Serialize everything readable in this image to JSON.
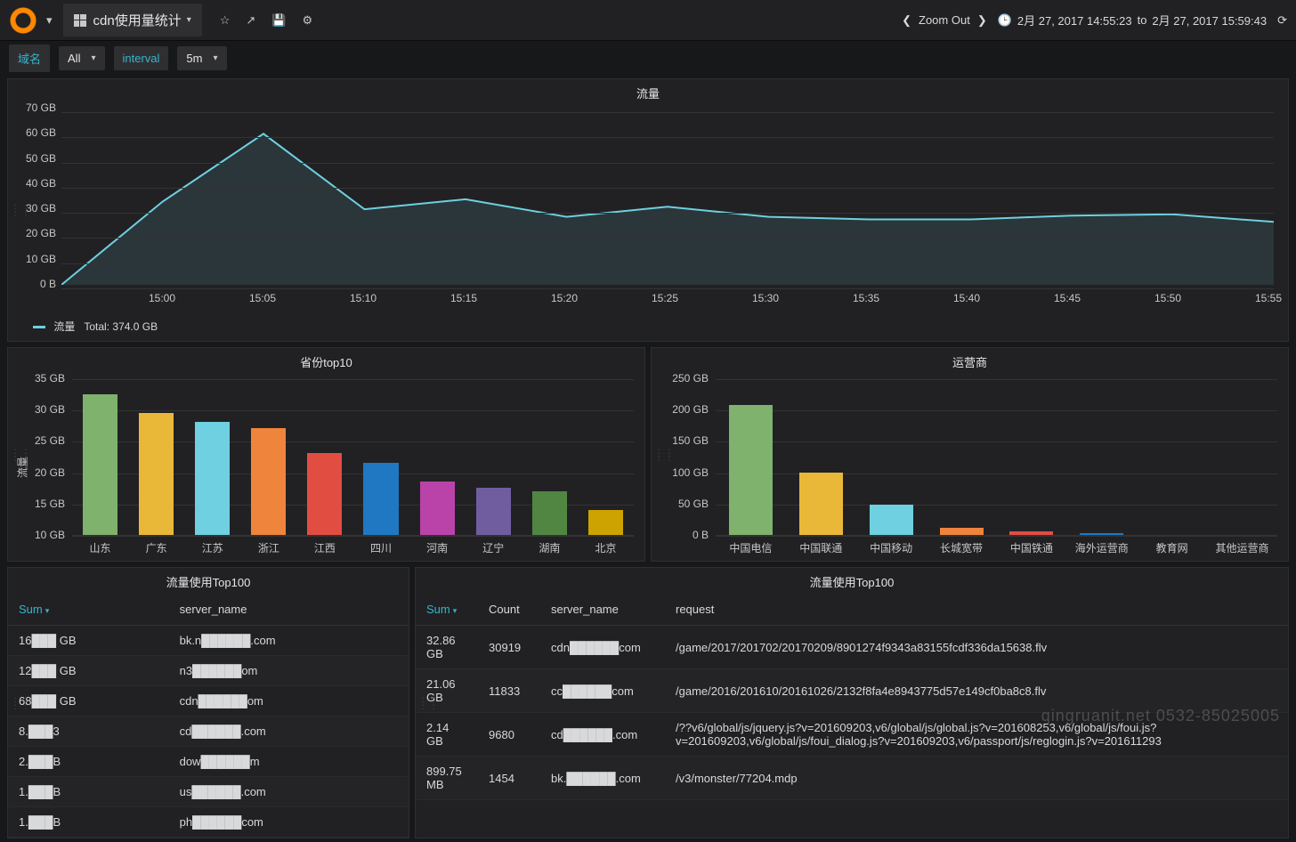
{
  "header": {
    "title": "cdn使用量统计",
    "zoom": "Zoom Out",
    "time_from": "2月 27, 2017 14:55:23",
    "time_to": "2月 27, 2017 15:59:43",
    "time_sep": "to"
  },
  "vars": {
    "domain_label": "域名",
    "domain_value": "All",
    "interval_label": "interval",
    "interval_value": "5m"
  },
  "panels": {
    "traffic_line": {
      "title": "流量",
      "legend_label": "流量",
      "legend_total_label": "Total:",
      "legend_total_value": "374.0 GB"
    },
    "province_bar": {
      "title": "省份top10",
      "ylabel": "流量"
    },
    "isp_bar": {
      "title": "运营商"
    },
    "table1": {
      "title": "流量使用Top100",
      "cols": {
        "sum": "Sum",
        "server": "server_name"
      }
    },
    "table2": {
      "title": "流量使用Top100",
      "cols": {
        "sum": "Sum",
        "count": "Count",
        "server": "server_name",
        "request": "request"
      }
    }
  },
  "chart_data": {
    "traffic_line": {
      "type": "line",
      "x_labels": [
        "15:00",
        "15:05",
        "15:10",
        "15:15",
        "15:20",
        "15:25",
        "15:30",
        "15:35",
        "15:40",
        "15:45",
        "15:50",
        "15:55"
      ],
      "y_ticks": [
        "0 B",
        "10 GB",
        "20 GB",
        "30 GB",
        "40 GB",
        "50 GB",
        "60 GB",
        "70 GB"
      ],
      "y_values_gb": [
        0,
        33,
        60,
        30,
        34,
        27,
        31,
        27,
        26,
        26,
        27.5,
        28,
        25
      ],
      "ylim_gb": [
        0,
        70
      ],
      "color": "#6ed0e0"
    },
    "province_bar": {
      "type": "bar",
      "categories": [
        "山东",
        "广东",
        "江苏",
        "浙江",
        "江西",
        "四川",
        "河南",
        "辽宁",
        "湖南",
        "北京"
      ],
      "values_gb": [
        32.5,
        29.5,
        28,
        27,
        23,
        21.5,
        18.5,
        17.5,
        17,
        14
      ],
      "y_ticks": [
        "10 GB",
        "15 GB",
        "20 GB",
        "25 GB",
        "30 GB",
        "35 GB"
      ],
      "ylim_gb": [
        10,
        35
      ],
      "colors": [
        "#7eb26d",
        "#eab839",
        "#6ed0e0",
        "#ef843c",
        "#e24d42",
        "#1f78c1",
        "#ba43a9",
        "#705da0",
        "#508642",
        "#cca300"
      ]
    },
    "isp_bar": {
      "type": "bar",
      "categories": [
        "中国电信",
        "中国联通",
        "中国移动",
        "长城宽带",
        "中国铁通",
        "海外运营商",
        "教育网",
        "其他运营商"
      ],
      "values_gb": [
        208,
        100,
        48,
        11,
        5,
        3,
        0,
        0
      ],
      "y_ticks": [
        "0 B",
        "50 GB",
        "100 GB",
        "150 GB",
        "200 GB",
        "250 GB"
      ],
      "ylim_gb": [
        0,
        250
      ],
      "colors": [
        "#7eb26d",
        "#eab839",
        "#6ed0e0",
        "#ef843c",
        "#e24d42",
        "#1f78c1",
        "#ba43a9",
        "#705da0"
      ]
    }
  },
  "table1_rows": [
    {
      "sum": "16███ GB",
      "server": "bk.n██████.com"
    },
    {
      "sum": "12███ GB",
      "server": "n3██████om"
    },
    {
      "sum": "68███ GB",
      "server": "cdn██████om"
    },
    {
      "sum": "8.███3",
      "server": "cd██████.com"
    },
    {
      "sum": "2.███B",
      "server": "dow██████m"
    },
    {
      "sum": "1.███B",
      "server": "us██████.com"
    },
    {
      "sum": "1.███B",
      "server": "ph██████com"
    }
  ],
  "table2_rows": [
    {
      "sum": "32.86 GB",
      "count": "30919",
      "server": "cdn██████com",
      "request": "/game/2017/201702/20170209/8901274f9343a83155fcdf336da15638.flv"
    },
    {
      "sum": "21.06 GB",
      "count": "11833",
      "server": "cc██████com",
      "request": "/game/2016/201610/20161026/2132f8fa4e8943775d57e149cf0ba8c8.flv"
    },
    {
      "sum": "2.14 GB",
      "count": "9680",
      "server": "cd██████.com",
      "request": "/??v6/global/js/jquery.js?v=201609203,v6/global/js/global.js?v=201608253,v6/global/js/foui.js?v=201609203,v6/global/js/foui_dialog.js?v=201609203,v6/passport/js/reglogin.js?v=201611293"
    },
    {
      "sum": "899.75 MB",
      "count": "1454",
      "server": "bk.██████.com",
      "request": "/v3/monster/77204.mdp"
    }
  ],
  "watermark": "qingruanit.net 0532-85025005"
}
